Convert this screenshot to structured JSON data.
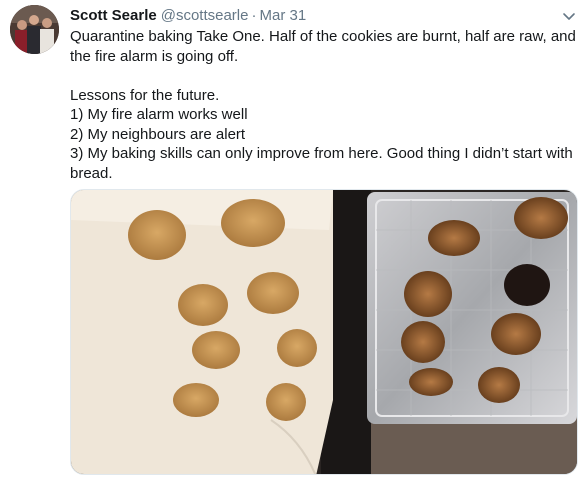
{
  "tweet": {
    "author": {
      "display_name": "Scott Searle",
      "handle": "@scottsearle",
      "avatar_icon": "user-avatar-photo"
    },
    "separator": "·",
    "date": "Mar 31",
    "menu_icon": "chevron-down-icon",
    "text_lines": [
      "Quarantine baking Take One. Half of the cookies are burnt, half are raw, and",
      "the fire alarm is going off.",
      "",
      "Lessons for the future.",
      "1) My fire alarm works well",
      "2) My neighbours are alert",
      "3) My baking skills can only improve from here. Good thing I didn’t start with",
      "bread."
    ],
    "media": {
      "kind": "photo",
      "description_icon": "cookies-photo"
    }
  },
  "colors": {
    "text_primary": "#14171a",
    "text_secondary": "#657786",
    "border": "#e1e8ed"
  }
}
